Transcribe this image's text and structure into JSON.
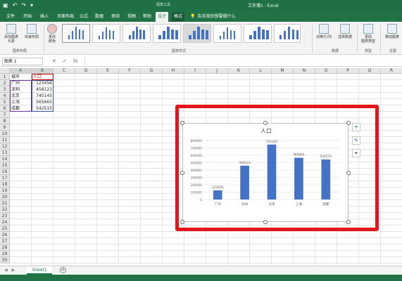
{
  "title_bar": {
    "context_label": "图表工具",
    "window_title": "工作簿1 - Excel",
    "quick_access": [
      "save-icon",
      "undo-icon",
      "redo-icon",
      "customize-icon"
    ]
  },
  "tabs": [
    {
      "label": "文件"
    },
    {
      "label": "开始"
    },
    {
      "label": "插入"
    },
    {
      "label": "页面布局"
    },
    {
      "label": "公式"
    },
    {
      "label": "数据"
    },
    {
      "label": "审阅"
    },
    {
      "label": "视图"
    },
    {
      "label": "帮助"
    },
    {
      "label": "设计"
    },
    {
      "label": "格式"
    }
  ],
  "tell_me": "告诉我你想要做什么",
  "ribbon": {
    "add_element": "添加图表\n元素",
    "quick_layout": "快速布局",
    "change_colors": "更改\n颜色",
    "group_layouts": "图表布局",
    "group_styles": "图表样式",
    "switch_row_col": "切换行/列",
    "select_data": "选择数据",
    "group_data": "数据",
    "change_type": "更改\n图表类型",
    "group_type": "类型",
    "move_chart": "移动图表",
    "group_location": "位置"
  },
  "formula_bar": {
    "name_box": "图表 1",
    "cancel": "✕",
    "enter": "✓",
    "fx": "fx",
    "value": ""
  },
  "columns": [
    "A",
    "B",
    "C",
    "D",
    "E",
    "F",
    "G",
    "H",
    "I",
    "J",
    "K",
    "L",
    "M",
    "N",
    "O",
    "P",
    "Q",
    "R"
  ],
  "rows": [
    "1",
    "2",
    "3",
    "4",
    "5",
    "6",
    "7",
    "8",
    "9",
    "10",
    "11",
    "12",
    "13",
    "14",
    "15",
    "16",
    "17",
    "18",
    "19",
    "20",
    "21",
    "22",
    "23",
    "24",
    "25",
    "26",
    "27",
    "28",
    "29",
    "30"
  ],
  "table": {
    "header": [
      "城市",
      "人口"
    ],
    "rows": [
      [
        "广州",
        "123456"
      ],
      [
        "深圳",
        "458123"
      ],
      [
        "北京",
        "745145"
      ],
      [
        "上海",
        "565665"
      ],
      [
        "成都",
        "542515"
      ]
    ]
  },
  "chart_data": {
    "type": "bar",
    "title": "人口",
    "categories": [
      "广州",
      "深圳",
      "北京",
      "上海",
      "成都"
    ],
    "series": [
      {
        "name": "人口",
        "values": [
          123456,
          458123,
          745145,
          565665,
          542515
        ]
      }
    ],
    "data_labels": [
      "123456",
      "458123",
      "745145",
      "565665",
      "542515"
    ],
    "yticks": [
      "0",
      "100000",
      "200000",
      "300000",
      "400000",
      "500000",
      "600000",
      "700000",
      "800000"
    ],
    "ylim": [
      0,
      800000
    ],
    "grid": true,
    "color": "#4472c4"
  },
  "chart_side_buttons": [
    "chart-elements-plus-icon",
    "chart-styles-brush-icon",
    "chart-filter-icon"
  ],
  "sheet": {
    "tab": "Sheet1",
    "add": "+"
  },
  "colors": {
    "excel_green": "#217346",
    "highlight_red": "#e4141b",
    "bar_blue": "#4472c4"
  }
}
